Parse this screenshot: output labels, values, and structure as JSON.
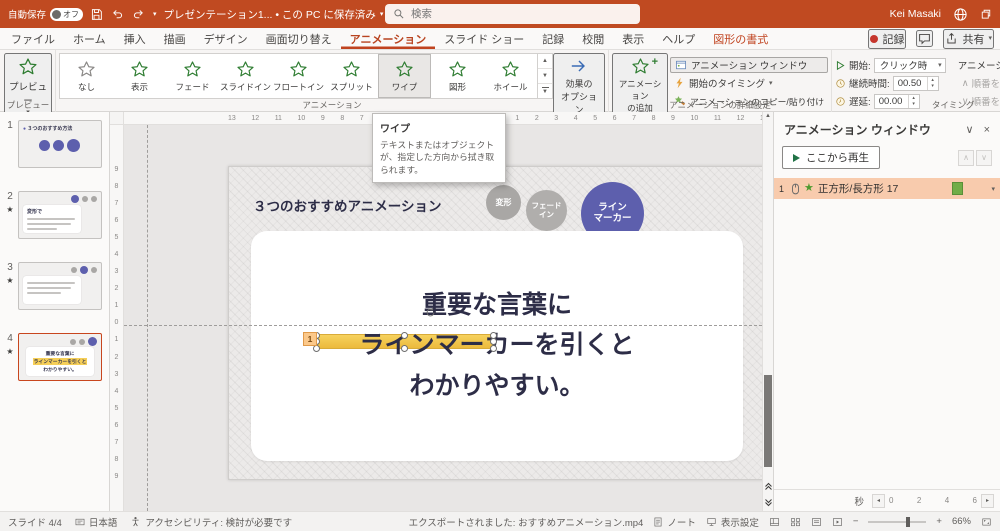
{
  "colors": {
    "titlebar": "#c04a21",
    "accent": "#c0431f",
    "star_green": "#2f7d32",
    "circle_purple": "#5d5fad",
    "marker_yellow": "#f3c94f",
    "selection_peach": "#f8cbad",
    "timeline_green": "#71ad47"
  },
  "titlebar": {
    "autosave_label": "自動保存",
    "autosave_state": "オフ",
    "doc_title": "プレゼンテーション1... • この PC に保存済み",
    "search_placeholder": "検索",
    "user_name": "Kei Masaki"
  },
  "tabs": [
    {
      "label": "ファイル"
    },
    {
      "label": "ホーム"
    },
    {
      "label": "挿入"
    },
    {
      "label": "描画"
    },
    {
      "label": "デザイン"
    },
    {
      "label": "画面切り替え"
    },
    {
      "label": "アニメーション",
      "state": "active"
    },
    {
      "label": "スライド ショー"
    },
    {
      "label": "記録"
    },
    {
      "label": "校閲"
    },
    {
      "label": "表示"
    },
    {
      "label": "ヘルプ"
    },
    {
      "label": "図形の書式",
      "state": "contextual"
    }
  ],
  "tab_actions": {
    "record": "記録",
    "share": "共有"
  },
  "ribbon": {
    "preview": {
      "label": "プレビュー",
      "group_label": "プレビュー"
    },
    "gallery": {
      "items": [
        {
          "label": "なし",
          "state": "none"
        },
        {
          "label": "表示"
        },
        {
          "label": "フェード"
        },
        {
          "label": "スライドイン"
        },
        {
          "label": "フロートイン"
        },
        {
          "label": "スプリット"
        },
        {
          "label": "ワイプ",
          "state": "hover"
        },
        {
          "label": "図形"
        },
        {
          "label": "ホイール"
        }
      ],
      "group_label": "アニメーション"
    },
    "effect_options_label": "効果の\nオプション",
    "advanced": {
      "add_label": "アニメーション\nの追加",
      "pane_label": "アニメーション ウィンドウ",
      "trigger_label": "開始のタイミング",
      "painter_label": "アニメーションのコピー/貼り付け",
      "group_label": "アニメーションの詳細設定"
    },
    "timing": {
      "start_label": "開始:",
      "start_value": "クリック時",
      "duration_label": "継続時間:",
      "duration_value": "00.50",
      "delay_label": "遅延:",
      "delay_value": "00.00",
      "reorder_label": "アニメーションの順序変更",
      "earlier": "順番を前にする",
      "later": "順番を後にする",
      "group_label": "タイミング"
    }
  },
  "tooltip": {
    "title": "ワイプ",
    "body": "テキストまたはオブジェクトが、指定した方向から拭き取られます。"
  },
  "thumbnails": [
    {
      "number": "1",
      "star": "",
      "title": "３つのおすすめ方法"
    },
    {
      "number": "2",
      "star": "★",
      "heading": "変形で"
    },
    {
      "number": "3",
      "star": "★",
      "heading": "フェードインで"
    },
    {
      "number": "4",
      "star": "★"
    }
  ],
  "rulers": {
    "h": [
      "13",
      "12",
      "11",
      "10",
      "9",
      "8",
      "7",
      "6",
      "5",
      "4",
      "3",
      "2",
      "1",
      "0",
      "1",
      "2",
      "3",
      "4",
      "5",
      "6",
      "7",
      "8",
      "9",
      "10",
      "11",
      "12",
      "13"
    ],
    "v": [
      "9",
      "8",
      "7",
      "6",
      "5",
      "4",
      "3",
      "2",
      "1",
      "0",
      "1",
      "2",
      "3",
      "4",
      "5",
      "6",
      "7",
      "8",
      "9"
    ]
  },
  "slide": {
    "title": "３つのおすすめアニメーション",
    "circle1": "変形",
    "circle2": "フェード\nイン",
    "circle3": "ライン\nマーカー",
    "line1": "重要な言葉に",
    "line2": "ラインマーカーを引くと",
    "line3": "わかりやすい。",
    "badge": "1"
  },
  "anim_pane": {
    "title": "アニメーション ウィンドウ",
    "play_label": "ここから再生",
    "item_number": "1",
    "item_label": "正方形/長方形 17",
    "seconds_label": "秒",
    "scale": [
      "0",
      "2",
      "4",
      "6"
    ]
  },
  "statusbar": {
    "slide": "スライド 4/4",
    "language": "日本語",
    "accessibility": "アクセシビリティ: 検討が必要です",
    "export": "エクスポートされました: おすすめアニメーション.mp4",
    "notes": "ノート",
    "display": "表示設定",
    "zoom": "66%"
  }
}
